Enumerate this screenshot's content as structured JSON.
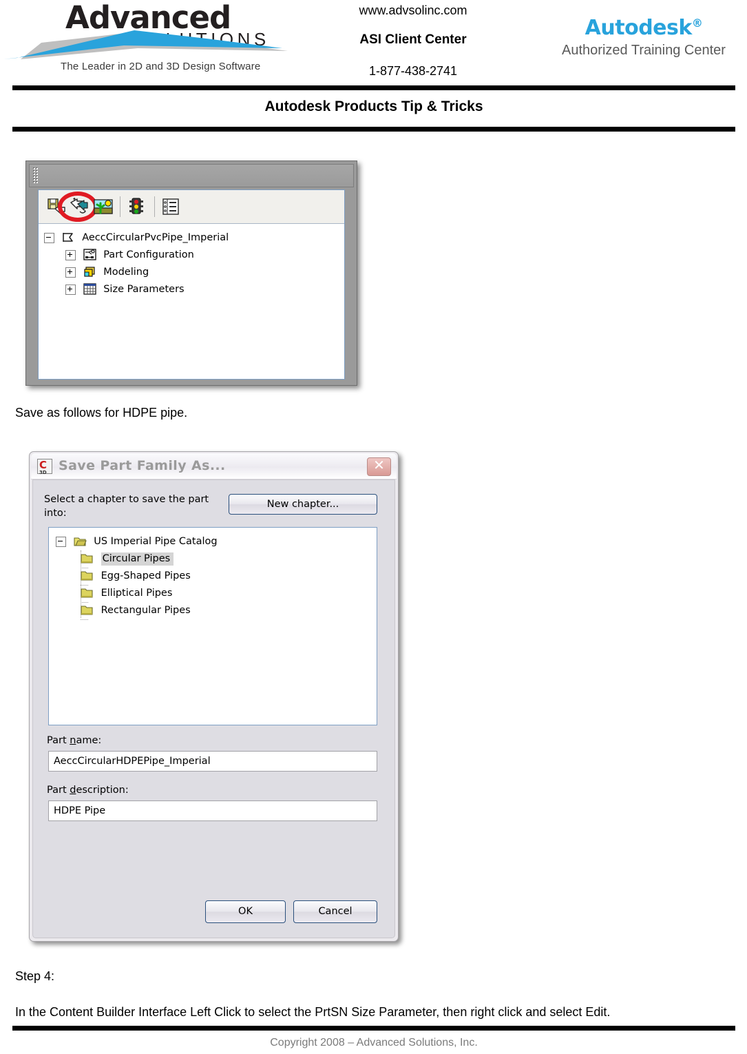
{
  "header": {
    "logo_primary_word": "Advanced",
    "logo_secondary_word": "SOLUTIONS",
    "logo_tagline": "The Leader in 2D and 3D Design Software",
    "website": "www.advsolinc.com",
    "center_name": "ASI Client Center",
    "phone": "1-877-438-2741",
    "autodesk_wordmark": "Autodesk",
    "autodesk_trademark": "®",
    "autodesk_subtitle": "Authorized Training Center",
    "accent_blue": "#29a3dc",
    "rule_color": "#000000"
  },
  "document": {
    "title": "Autodesk Products Tip & Tricks",
    "footer": "Copyright 2008 – Advanced Solutions, Inc."
  },
  "body_text": {
    "save_as_follows": "Save as follows for HDPE pipe.",
    "step_heading": "Step 4:",
    "step_detail": "In the Content Builder Interface Left Click to select the PrtSN Size Parameter, then right click and select Edit."
  },
  "content_builder_panel": {
    "toolbar_icons": [
      {
        "name": "save-part-family-icon",
        "highlighted": false
      },
      {
        "name": "save-part-family-as-icon",
        "highlighted": true
      },
      {
        "name": "part-builder-preview-icon",
        "highlighted": false
      },
      {
        "name": "validate-traffic-light-icon",
        "highlighted": false
      },
      {
        "name": "parameters-list-icon",
        "highlighted": false
      }
    ],
    "highlight_color": "#e01b23",
    "tree": [
      {
        "label": "AeccCircularPvcPipe_Imperial",
        "toggle": "minus",
        "icon": "part-family-flag-icon",
        "level": 0
      },
      {
        "label": "Part Configuration",
        "toggle": "plus",
        "icon": "part-configuration-icon",
        "level": 1
      },
      {
        "label": "Modeling",
        "toggle": "plus",
        "icon": "modeling-icon",
        "level": 1
      },
      {
        "label": "Size Parameters",
        "toggle": "plus",
        "icon": "size-parameters-grid-icon",
        "level": 1
      }
    ]
  },
  "save_dialog": {
    "title": "Save Part Family As...",
    "app_icon": "civil3d-icon",
    "app_icon_letter": "C",
    "app_icon_sub": "3D",
    "close_label": "✕",
    "prompt": "Select a chapter to save the part into:",
    "new_chapter_button": "New chapter...",
    "tree": [
      {
        "label": "US Imperial Pipe Catalog",
        "toggle": "minus",
        "icon": "open-folder-icon",
        "level": 0,
        "selected": false
      },
      {
        "label": "Circular Pipes",
        "toggle": "none",
        "icon": "folder-icon",
        "level": 1,
        "selected": true
      },
      {
        "label": "Egg-Shaped Pipes",
        "toggle": "none",
        "icon": "folder-icon",
        "level": 1,
        "selected": false
      },
      {
        "label": "Elliptical Pipes",
        "toggle": "none",
        "icon": "folder-icon",
        "level": 1,
        "selected": false
      },
      {
        "label": "Rectangular Pipes",
        "toggle": "none",
        "icon": "folder-icon",
        "level": 1,
        "selected": false
      }
    ],
    "part_name_label": "Part name:",
    "part_name_value": "AeccCircularHDPEPipe_Imperial",
    "part_description_label": "Part description:",
    "part_description_value": "HDPE Pipe",
    "ok_button": "OK",
    "cancel_button": "Cancel"
  }
}
